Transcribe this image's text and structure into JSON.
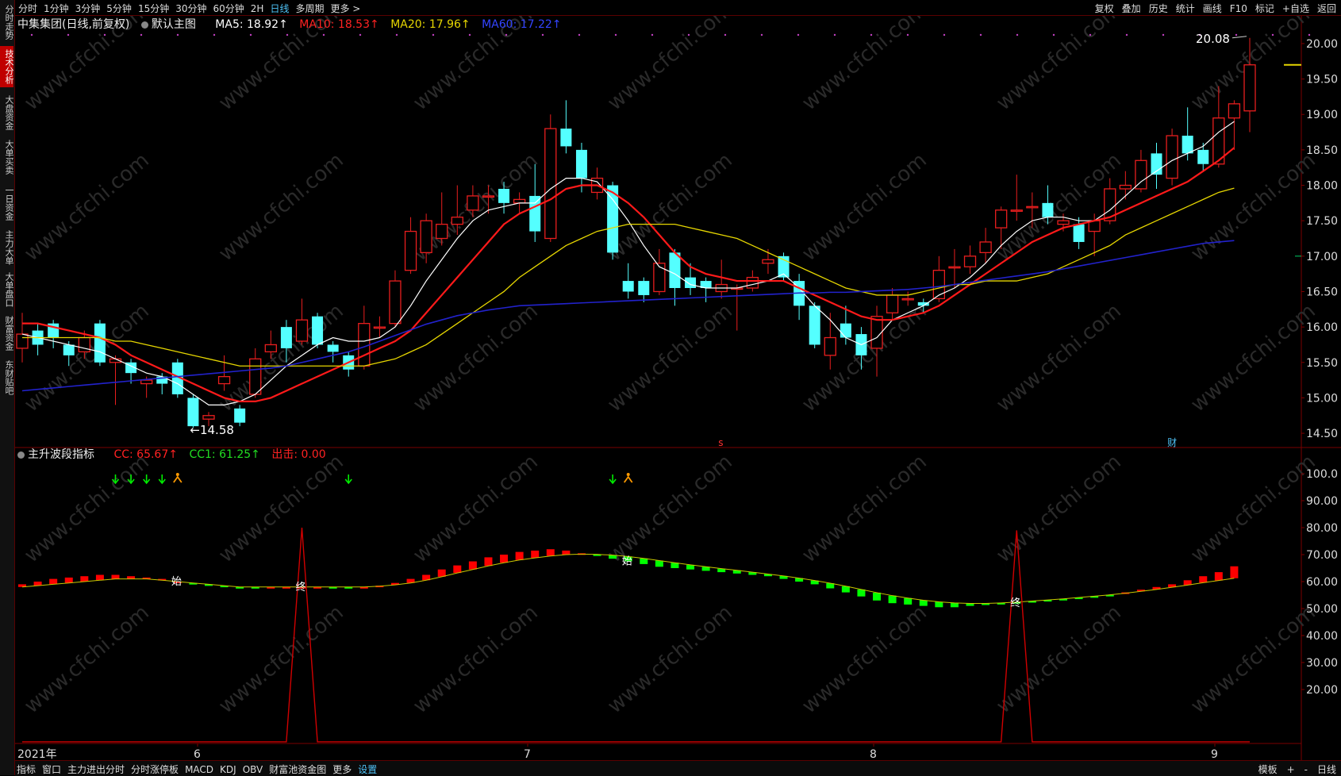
{
  "left_tabs": [
    {
      "label": "分时走势",
      "active": false
    },
    {
      "label": "技术分析",
      "active": true
    },
    {
      "label": "大盘资金",
      "active": false
    },
    {
      "label": "大单买卖",
      "active": false
    },
    {
      "label": "一日资金",
      "active": false
    },
    {
      "label": "主力大单",
      "active": false
    },
    {
      "label": "大单盘口",
      "active": false
    },
    {
      "label": "财富资金",
      "active": false
    },
    {
      "label": "东财贴吧",
      "active": false
    }
  ],
  "period_tabs": [
    "分时",
    "1分钟",
    "3分钟",
    "5分钟",
    "15分钟",
    "30分钟",
    "60分钟",
    "2H",
    "日线",
    "多周期",
    "更多 >"
  ],
  "active_period": "日线",
  "top_right_tools": [
    "复权",
    "叠加",
    "历史",
    "统计",
    "画线",
    "F10",
    "标记",
    "+自选",
    "返回"
  ],
  "info": {
    "title": "中集集团(日线,前复权)",
    "main_label": "默认主图",
    "ma5": "MA5: 18.92↑",
    "ma10": "MA10: 18.53↑",
    "ma20": "MA20: 17.96↑",
    "ma60": "MA60: 17.22↑"
  },
  "indicator_info": {
    "name": "主升波段指标",
    "cc": "CC: 65.67↑",
    "cc1": "CC1: 61.25↑",
    "exit": "出击: 0.00"
  },
  "bottom_tabs": [
    "指标",
    "窗口",
    "主力进出分时",
    "分时涨停板",
    "MACD",
    "KDJ",
    "OBV",
    "财富池资金图",
    "更多",
    "设置"
  ],
  "bottom_right": [
    "模板",
    "+",
    "-",
    "日线"
  ],
  "colors": {
    "up": "#e81e1e",
    "down": "#54ffff",
    "ma5": "#ffffff",
    "ma10": "#ff1a1a",
    "ma20": "#e6d600",
    "ma60": "#2222cc",
    "cc_up": "#ff0000",
    "cc_down": "#00ff00"
  },
  "chart_data": [
    {
      "type": "candlestick",
      "ylim": [
        14.4,
        20.1
      ],
      "y_ticks": [
        "20.00",
        "19.50",
        "19.00",
        "18.50",
        "18.00",
        "17.50",
        "17.00",
        "16.50",
        "16.00",
        "15.50",
        "15.00",
        "14.50"
      ],
      "x_labels": [
        "2021年",
        "6",
        "7",
        "8",
        "9"
      ],
      "annotations": {
        "high": "20.08",
        "low": "←14.58",
        "marker_s": "s",
        "marker_cai": "财"
      },
      "candles": [
        {
          "o": 15.7,
          "c": 15.9,
          "h": 16.2,
          "l": 15.5
        },
        {
          "o": 15.95,
          "c": 15.75,
          "h": 16.05,
          "l": 15.6
        },
        {
          "o": 16.05,
          "c": 15.85,
          "h": 16.1,
          "l": 15.7
        },
        {
          "o": 15.75,
          "c": 15.6,
          "h": 15.8,
          "l": 15.45
        },
        {
          "o": 15.65,
          "c": 15.85,
          "h": 15.95,
          "l": 15.55
        },
        {
          "o": 16.05,
          "c": 15.5,
          "h": 16.1,
          "l": 15.45
        },
        {
          "o": 15.5,
          "c": 15.55,
          "h": 15.6,
          "l": 14.9
        },
        {
          "o": 15.5,
          "c": 15.35,
          "h": 15.55,
          "l": 15.2
        },
        {
          "o": 15.2,
          "c": 15.25,
          "h": 15.3,
          "l": 15.0
        },
        {
          "o": 15.3,
          "c": 15.2,
          "h": 15.35,
          "l": 15.05
        },
        {
          "o": 15.5,
          "c": 15.05,
          "h": 15.55,
          "l": 15.0
        },
        {
          "o": 15.0,
          "c": 14.6,
          "h": 15.05,
          "l": 14.58
        },
        {
          "o": 14.7,
          "c": 14.75,
          "h": 14.8,
          "l": 14.6
        },
        {
          "o": 15.2,
          "c": 15.3,
          "h": 15.6,
          "l": 15.1
        },
        {
          "o": 14.85,
          "c": 14.65,
          "h": 14.9,
          "l": 14.6
        },
        {
          "o": 15.05,
          "c": 15.55,
          "h": 15.7,
          "l": 15.0
        },
        {
          "o": 15.65,
          "c": 15.75,
          "h": 15.95,
          "l": 15.55
        },
        {
          "o": 16.0,
          "c": 15.7,
          "h": 16.1,
          "l": 15.5
        },
        {
          "o": 15.8,
          "c": 16.1,
          "h": 16.4,
          "l": 15.75
        },
        {
          "o": 16.15,
          "c": 15.75,
          "h": 16.2,
          "l": 15.7
        },
        {
          "o": 15.75,
          "c": 15.65,
          "h": 15.8,
          "l": 15.5
        },
        {
          "o": 15.6,
          "c": 15.4,
          "h": 15.65,
          "l": 15.3
        },
        {
          "o": 15.45,
          "c": 16.05,
          "h": 16.3,
          "l": 15.4
        },
        {
          "o": 16.0,
          "c": 16.0,
          "h": 16.15,
          "l": 15.85
        },
        {
          "o": 16.05,
          "c": 16.65,
          "h": 16.8,
          "l": 16.0
        },
        {
          "o": 16.8,
          "c": 17.35,
          "h": 17.55,
          "l": 16.75
        },
        {
          "o": 17.05,
          "c": 17.5,
          "h": 17.6,
          "l": 16.9
        },
        {
          "o": 17.25,
          "c": 17.45,
          "h": 17.9,
          "l": 17.15
        },
        {
          "o": 17.45,
          "c": 17.55,
          "h": 18.0,
          "l": 17.3
        },
        {
          "o": 17.65,
          "c": 17.85,
          "h": 18.0,
          "l": 17.55
        },
        {
          "o": 17.85,
          "c": 17.85,
          "h": 18.0,
          "l": 17.6
        },
        {
          "o": 17.95,
          "c": 17.75,
          "h": 18.05,
          "l": 17.6
        },
        {
          "o": 17.75,
          "c": 17.8,
          "h": 17.9,
          "l": 17.6
        },
        {
          "o": 17.85,
          "c": 17.35,
          "h": 18.3,
          "l": 17.2
        },
        {
          "o": 17.25,
          "c": 18.8,
          "h": 19.0,
          "l": 17.2
        },
        {
          "o": 18.8,
          "c": 18.55,
          "h": 19.2,
          "l": 18.45
        },
        {
          "o": 18.5,
          "c": 18.1,
          "h": 18.6,
          "l": 17.9
        },
        {
          "o": 17.9,
          "c": 18.1,
          "h": 18.25,
          "l": 17.8
        },
        {
          "o": 18.0,
          "c": 17.05,
          "h": 18.05,
          "l": 16.95
        },
        {
          "o": 16.65,
          "c": 16.5,
          "h": 16.9,
          "l": 16.4
        },
        {
          "o": 16.65,
          "c": 16.45,
          "h": 16.7,
          "l": 16.35
        },
        {
          "o": 16.5,
          "c": 16.9,
          "h": 17.1,
          "l": 16.45
        },
        {
          "o": 17.05,
          "c": 16.55,
          "h": 17.1,
          "l": 16.3
        },
        {
          "o": 16.7,
          "c": 16.55,
          "h": 16.9,
          "l": 16.45
        },
        {
          "o": 16.65,
          "c": 16.55,
          "h": 16.7,
          "l": 16.35
        },
        {
          "o": 16.5,
          "c": 16.6,
          "h": 16.95,
          "l": 16.4
        },
        {
          "o": 16.55,
          "c": 16.55,
          "h": 16.6,
          "l": 15.95
        },
        {
          "o": 16.55,
          "c": 16.7,
          "h": 16.8,
          "l": 16.5
        },
        {
          "o": 16.9,
          "c": 16.95,
          "h": 17.1,
          "l": 16.75
        },
        {
          "o": 17.0,
          "c": 16.7,
          "h": 17.05,
          "l": 16.65
        },
        {
          "o": 16.65,
          "c": 16.3,
          "h": 16.75,
          "l": 16.1
        },
        {
          "o": 16.3,
          "c": 15.75,
          "h": 16.35,
          "l": 15.7
        },
        {
          "o": 15.6,
          "c": 15.85,
          "h": 16.2,
          "l": 15.4
        },
        {
          "o": 16.05,
          "c": 15.85,
          "h": 16.3,
          "l": 15.75
        },
        {
          "o": 15.9,
          "c": 15.6,
          "h": 16.0,
          "l": 15.4
        },
        {
          "o": 15.7,
          "c": 16.15,
          "h": 16.3,
          "l": 15.3
        },
        {
          "o": 16.2,
          "c": 16.45,
          "h": 16.55,
          "l": 16.1
        },
        {
          "o": 16.4,
          "c": 16.4,
          "h": 16.5,
          "l": 16.3
        },
        {
          "o": 16.35,
          "c": 16.3,
          "h": 16.4,
          "l": 16.2
        },
        {
          "o": 16.4,
          "c": 16.8,
          "h": 17.0,
          "l": 16.35
        },
        {
          "o": 16.85,
          "c": 16.85,
          "h": 17.1,
          "l": 16.55
        },
        {
          "o": 16.85,
          "c": 17.0,
          "h": 17.15,
          "l": 16.75
        },
        {
          "o": 17.05,
          "c": 17.2,
          "h": 17.4,
          "l": 16.9
        },
        {
          "o": 17.4,
          "c": 17.65,
          "h": 17.7,
          "l": 17.1
        },
        {
          "o": 17.65,
          "c": 17.65,
          "h": 18.15,
          "l": 17.5
        },
        {
          "o": 17.7,
          "c": 17.7,
          "h": 17.9,
          "l": 17.4
        },
        {
          "o": 17.75,
          "c": 17.55,
          "h": 18.0,
          "l": 17.45
        },
        {
          "o": 17.45,
          "c": 17.5,
          "h": 17.6,
          "l": 17.35
        },
        {
          "o": 17.45,
          "c": 17.2,
          "h": 17.55,
          "l": 17.1
        },
        {
          "o": 17.35,
          "c": 17.5,
          "h": 17.6,
          "l": 17.0
        },
        {
          "o": 17.5,
          "c": 17.95,
          "h": 18.1,
          "l": 17.45
        },
        {
          "o": 17.95,
          "c": 18.0,
          "h": 18.2,
          "l": 17.8
        },
        {
          "o": 17.95,
          "c": 18.35,
          "h": 18.5,
          "l": 17.9
        },
        {
          "o": 18.45,
          "c": 18.15,
          "h": 18.6,
          "l": 17.95
        },
        {
          "o": 18.1,
          "c": 18.7,
          "h": 18.8,
          "l": 18.0
        },
        {
          "o": 18.7,
          "c": 18.45,
          "h": 19.1,
          "l": 18.35
        },
        {
          "o": 18.5,
          "c": 18.3,
          "h": 18.6,
          "l": 18.2
        },
        {
          "o": 18.3,
          "c": 18.95,
          "h": 19.4,
          "l": 18.25
        },
        {
          "o": 18.95,
          "c": 19.15,
          "h": 19.2,
          "l": 18.5
        },
        {
          "o": 19.05,
          "c": 19.7,
          "h": 20.08,
          "l": 18.75
        }
      ],
      "series": [
        {
          "name": "MA5",
          "values": [
            15.9,
            15.85,
            15.8,
            15.75,
            15.7,
            15.65,
            15.55,
            15.45,
            15.35,
            15.3,
            15.2,
            15.05,
            14.9,
            14.9,
            14.95,
            15.05,
            15.25,
            15.45,
            15.6,
            15.75,
            15.85,
            15.8,
            15.8,
            15.85,
            16.0,
            16.3,
            16.65,
            16.95,
            17.25,
            17.5,
            17.65,
            17.7,
            17.75,
            17.75,
            17.95,
            18.1,
            18.1,
            18.05,
            17.8,
            17.5,
            17.15,
            16.85,
            16.75,
            16.6,
            16.55,
            16.55,
            16.55,
            16.6,
            16.65,
            16.75,
            16.55,
            16.3,
            16.1,
            15.85,
            15.75,
            15.85,
            16.1,
            16.2,
            16.3,
            16.45,
            16.55,
            16.7,
            16.9,
            17.15,
            17.35,
            17.5,
            17.55,
            17.55,
            17.5,
            17.5,
            17.65,
            17.85,
            18.05,
            18.2,
            18.35,
            18.45,
            18.55,
            18.75,
            18.9
          ]
        },
        {
          "name": "MA10",
          "values": [
            16.05,
            16.05,
            16.0,
            15.95,
            15.9,
            15.85,
            15.75,
            15.6,
            15.5,
            15.4,
            15.3,
            15.2,
            15.1,
            15.0,
            14.95,
            14.95,
            15.0,
            15.1,
            15.2,
            15.3,
            15.4,
            15.5,
            15.6,
            15.7,
            15.8,
            15.95,
            16.2,
            16.45,
            16.7,
            16.95,
            17.2,
            17.45,
            17.6,
            17.7,
            17.8,
            17.95,
            18.0,
            18.0,
            17.9,
            17.75,
            17.55,
            17.3,
            17.05,
            16.85,
            16.75,
            16.7,
            16.65,
            16.65,
            16.65,
            16.65,
            16.55,
            16.45,
            16.35,
            16.25,
            16.15,
            16.1,
            16.1,
            16.15,
            16.2,
            16.3,
            16.45,
            16.6,
            16.75,
            16.9,
            17.05,
            17.2,
            17.3,
            17.4,
            17.45,
            17.5,
            17.55,
            17.65,
            17.75,
            17.85,
            17.95,
            18.05,
            18.2,
            18.35,
            18.53
          ]
        },
        {
          "name": "MA20",
          "values": [
            15.85,
            15.85,
            15.85,
            15.85,
            15.85,
            15.85,
            15.8,
            15.8,
            15.75,
            15.7,
            15.65,
            15.6,
            15.55,
            15.5,
            15.45,
            15.45,
            15.45,
            15.45,
            15.45,
            15.45,
            15.45,
            15.45,
            15.45,
            15.5,
            15.55,
            15.65,
            15.75,
            15.9,
            16.05,
            16.2,
            16.35,
            16.5,
            16.7,
            16.85,
            17.0,
            17.15,
            17.25,
            17.35,
            17.4,
            17.45,
            17.45,
            17.45,
            17.45,
            17.4,
            17.35,
            17.3,
            17.25,
            17.15,
            17.05,
            16.95,
            16.85,
            16.75,
            16.65,
            16.55,
            16.5,
            16.45,
            16.45,
            16.45,
            16.5,
            16.55,
            16.6,
            16.6,
            16.65,
            16.65,
            16.65,
            16.7,
            16.75,
            16.85,
            16.95,
            17.05,
            17.15,
            17.3,
            17.4,
            17.5,
            17.6,
            17.7,
            17.8,
            17.9,
            17.96
          ]
        },
        {
          "name": "MA60",
          "values": [
            15.1,
            15.12,
            15.14,
            15.16,
            15.18,
            15.2,
            15.22,
            15.24,
            15.26,
            15.28,
            15.3,
            15.32,
            15.34,
            15.36,
            15.38,
            15.4,
            15.42,
            15.45,
            15.5,
            15.55,
            15.6,
            15.65,
            15.72,
            15.8,
            15.88,
            15.96,
            16.04,
            16.1,
            16.16,
            16.2,
            16.24,
            16.27,
            16.3,
            16.31,
            16.32,
            16.33,
            16.34,
            16.35,
            16.36,
            16.37,
            16.38,
            16.39,
            16.4,
            16.41,
            16.42,
            16.43,
            16.44,
            16.45,
            16.46,
            16.47,
            16.48,
            16.48,
            16.49,
            16.49,
            16.5,
            16.51,
            16.52,
            16.53,
            16.55,
            16.57,
            16.6,
            16.63,
            16.66,
            16.69,
            16.72,
            16.75,
            16.78,
            16.82,
            16.86,
            16.9,
            16.94,
            16.98,
            17.02,
            17.06,
            17.1,
            17.14,
            17.18,
            17.2,
            17.22
          ]
        }
      ]
    },
    {
      "type": "bar",
      "name": "主升波段指标",
      "ylim": [
        0,
        105
      ],
      "y_ticks": [
        "100.0",
        "90.00",
        "80.00",
        "70.00",
        "60.00",
        "50.00",
        "40.00",
        "30.00",
        "20.00"
      ],
      "cc": [
        59,
        60,
        61,
        61.5,
        62,
        62.5,
        62.5,
        62,
        61.5,
        61,
        60,
        59,
        58.5,
        58,
        57.5,
        57.5,
        58,
        58,
        58,
        58,
        57.5,
        57.5,
        58,
        58.5,
        59.5,
        61,
        62.5,
        64.5,
        66,
        67.5,
        69,
        70,
        71,
        71.5,
        72,
        71.5,
        70.5,
        69.5,
        68.5,
        67.5,
        66.5,
        65.5,
        65,
        64.5,
        64,
        63.5,
        63,
        62.5,
        62,
        61,
        60,
        59,
        57.5,
        56,
        54.5,
        53,
        52,
        51.5,
        51,
        50.5,
        50.5,
        51,
        51.5,
        52,
        52,
        52.5,
        53,
        53.5,
        54,
        54.5,
        55,
        56,
        57,
        58,
        59,
        60.5,
        62,
        63.5,
        65.67
      ],
      "cc1": [
        58,
        58.5,
        59,
        59.5,
        60,
        60.5,
        61,
        61,
        61,
        60.5,
        60,
        59.5,
        59,
        58.5,
        58,
        58,
        58,
        58,
        58,
        58,
        58,
        58,
        58,
        58.3,
        58.8,
        59.5,
        60.5,
        61.8,
        63.2,
        64.5,
        65.8,
        67,
        68,
        68.8,
        69.5,
        70,
        70.2,
        70.1,
        69.8,
        69.3,
        68.6,
        67.8,
        67,
        66.2,
        65.5,
        64.8,
        64.2,
        63.5,
        62.8,
        62.1,
        61.3,
        60.4,
        59.4,
        58.3,
        57.1,
        55.9,
        54.8,
        53.9,
        53.1,
        52.5,
        52.1,
        51.9,
        51.9,
        52.1,
        52.4,
        52.8,
        53.2,
        53.6,
        54.1,
        54.6,
        55.1,
        55.7,
        56.4,
        57.1,
        57.9,
        58.7,
        59.6,
        60.4,
        61.25
      ],
      "exit_spikes": [
        {
          "index": 18,
          "value": 80
        },
        {
          "index": 64,
          "value": 79
        }
      ],
      "signals": {
        "down_arrows": [
          6,
          7,
          8,
          9,
          21,
          38
        ],
        "person": [
          10,
          39
        ]
      },
      "labels": [
        {
          "index": 10,
          "text": "始"
        },
        {
          "index": 18,
          "text": "终"
        },
        {
          "index": 39,
          "text": "始"
        },
        {
          "index": 64,
          "text": "终"
        }
      ]
    }
  ],
  "watermark": "www.cfchi.com"
}
